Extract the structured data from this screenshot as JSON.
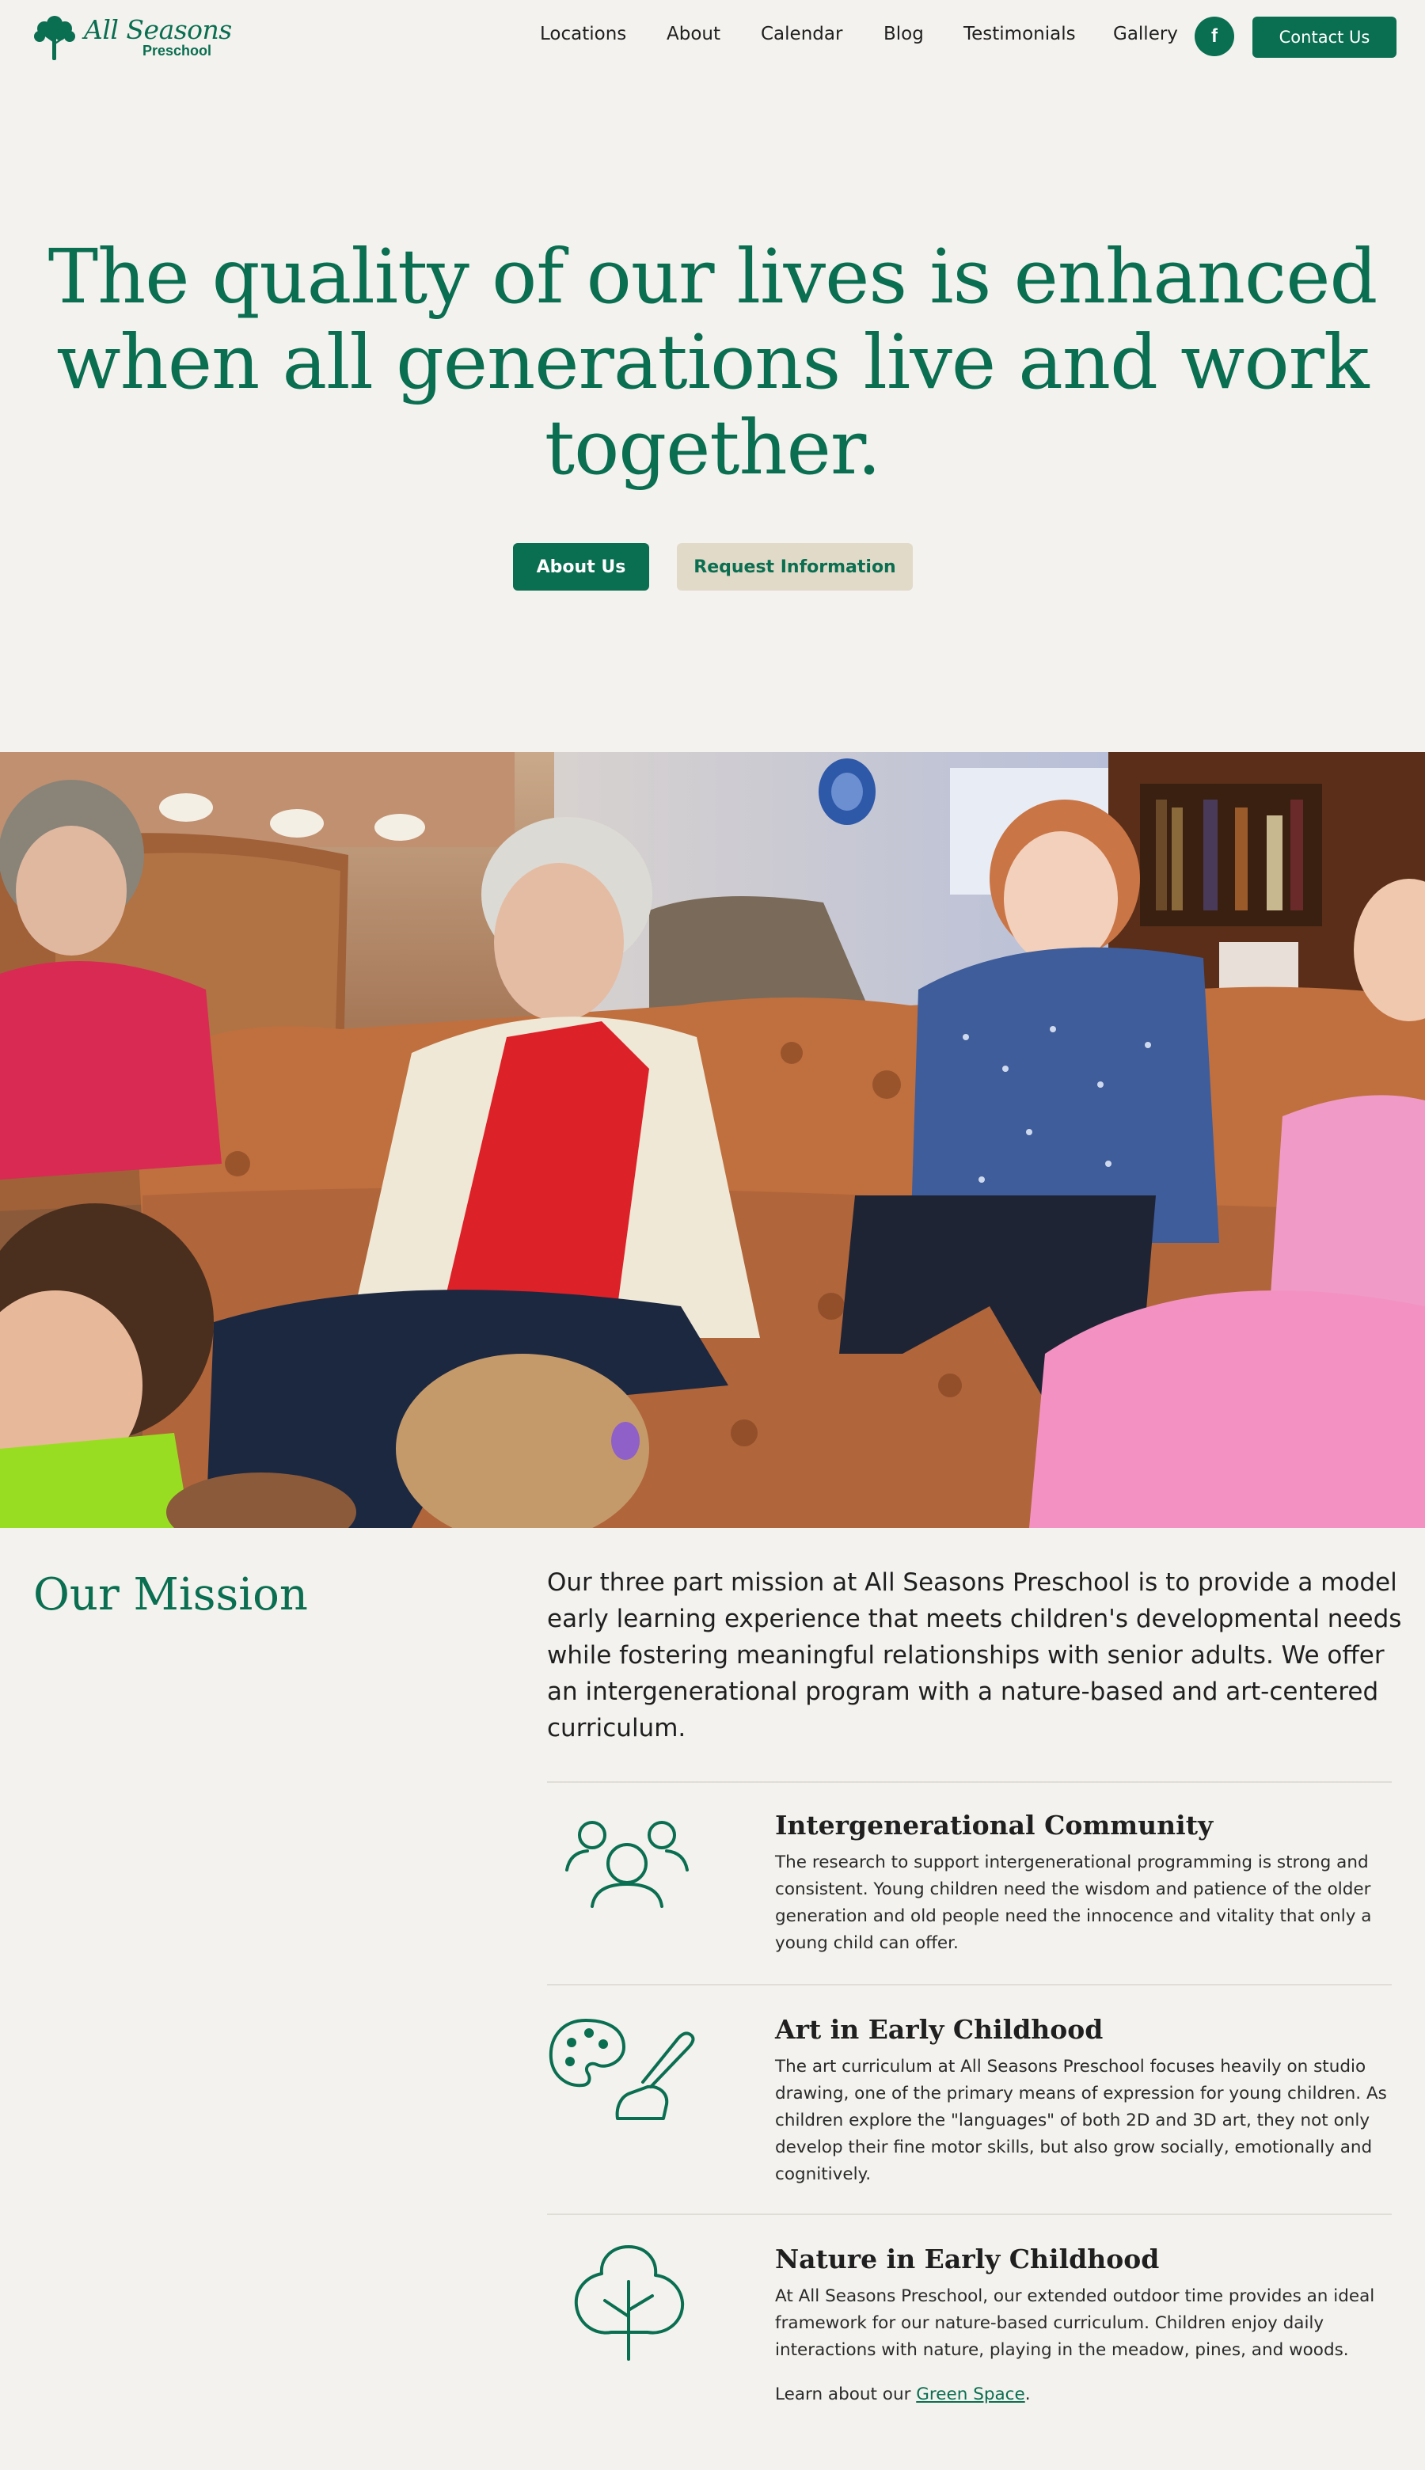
{
  "brand": {
    "logo_script": "All Seasons",
    "logo_sub": "Preschool",
    "accent": "#0a6e50",
    "secondary": "#e2dac8",
    "background": "#f3f2ee"
  },
  "nav": {
    "items": [
      {
        "label": "Locations"
      },
      {
        "label": "About"
      },
      {
        "label": "Calendar"
      },
      {
        "label": "Blog"
      },
      {
        "label": "Testimonials"
      },
      {
        "label": "Gallery"
      }
    ],
    "facebook_icon": "facebook-icon",
    "facebook_glyph": "f",
    "contact_label": "Contact Us"
  },
  "hero": {
    "lines": [
      "The quality of our lives is enhanced",
      "when all generations live and work",
      "together."
    ],
    "primary_button": "About Us",
    "secondary_button": "Request Information"
  },
  "mission": {
    "title": "Our Mission",
    "intro": "Our three part mission at All Seasons Preschool is to provide a model early learning experience that meets children's developmental needs while fostering meaningful relationships with senior adults. We offer an intergenerational program with a nature-based and art-centered curriculum.",
    "features": [
      {
        "icon": "people-icon",
        "title": "Intergenerational Community",
        "body": "The research to support intergenerational programming is strong and consistent. Young children need the wisdom and patience of the older generation and old people need the innocence and vitality that only a young child can offer."
      },
      {
        "icon": "palette-brush-icon",
        "title": "Art in Early Childhood",
        "body": "The art curriculum at All Seasons Preschool focuses heavily on studio drawing, one of the primary means of expression for young children. As children explore the \"languages\" of both 2D and 3D art, they not only develop their fine motor skills, but also grow socially, emotionally and cognitively."
      },
      {
        "icon": "tree-icon",
        "title": "Nature in Early Childhood",
        "body": "At All Seasons Preschool, our extended outdoor time provides an ideal framework for our nature-based curriculum. Children enjoy daily interactions with nature, playing in the meadow, pines, and woods.",
        "link_prefix": "Learn about our ",
        "link_text": "Green Space",
        "link_suffix": "."
      }
    ]
  }
}
